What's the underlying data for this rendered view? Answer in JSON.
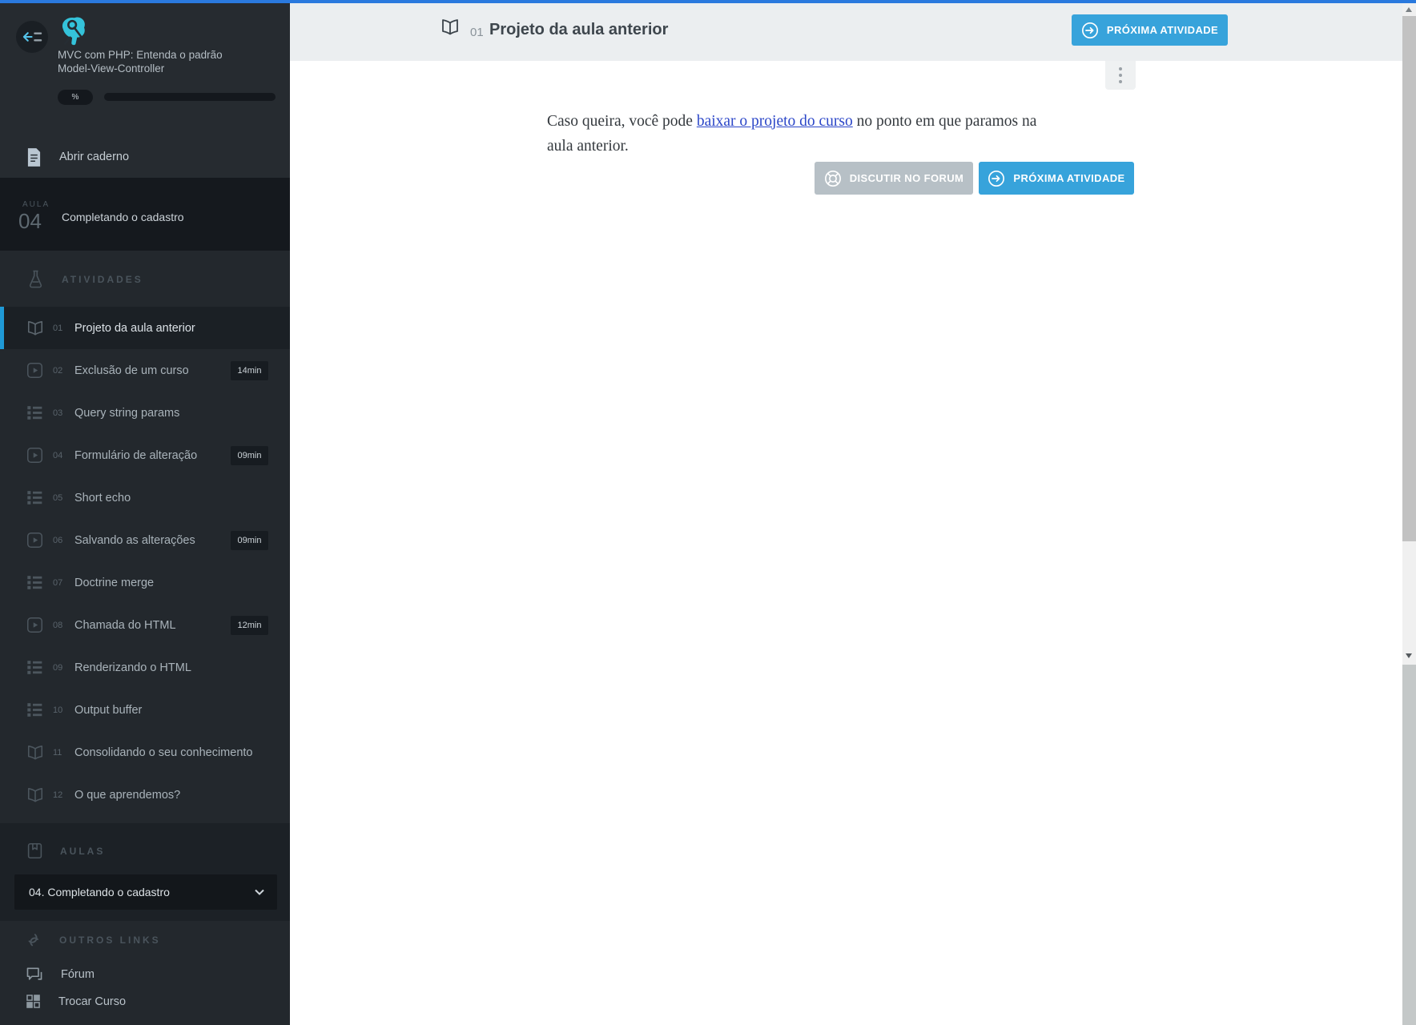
{
  "colors": {
    "top_line": "#2a79de",
    "active_accent": "#1f9ad7",
    "primary_button": "#37a3db",
    "forum_button": "#b7c0c6",
    "link_blue": "#2b46c8"
  },
  "sidebar": {
    "course_title_line1": "MVC com PHP: Entenda o padrão",
    "course_title_line2": "Model-View-Controller",
    "progress_label": "%",
    "notebook_label": "Abrir caderno",
    "aula": {
      "label": "AULA",
      "number": "04",
      "title": "Completando o cadastro"
    },
    "activities": {
      "header": "ATIVIDADES",
      "items": [
        {
          "num": "01",
          "label": "Projeto da aula anterior",
          "icon": "book",
          "active": true
        },
        {
          "num": "02",
          "label": "Exclusão de um curso",
          "icon": "video",
          "duration": "14min"
        },
        {
          "num": "03",
          "label": "Query string params",
          "icon": "list"
        },
        {
          "num": "04",
          "label": "Formulário de alteração",
          "icon": "video",
          "duration": "09min"
        },
        {
          "num": "05",
          "label": "Short echo",
          "icon": "list"
        },
        {
          "num": "06",
          "label": "Salvando as alterações",
          "icon": "video",
          "duration": "09min"
        },
        {
          "num": "07",
          "label": "Doctrine merge",
          "icon": "list"
        },
        {
          "num": "08",
          "label": "Chamada do HTML",
          "icon": "video",
          "duration": "12min"
        },
        {
          "num": "09",
          "label": "Renderizando o HTML",
          "icon": "list"
        },
        {
          "num": "10",
          "label": "Output buffer",
          "icon": "list"
        },
        {
          "num": "11",
          "label": "Consolidando o seu conhecimento",
          "icon": "book"
        },
        {
          "num": "12",
          "label": "O que aprendemos?",
          "icon": "book"
        }
      ]
    },
    "aulas": {
      "header": "AULAS",
      "selected": "04. Completando o cadastro"
    },
    "outros": {
      "header": "OUTROS LINKS",
      "forum": "Fórum",
      "trocar": "Trocar Curso"
    }
  },
  "main": {
    "header": {
      "num": "01",
      "title": "Projeto da aula anterior",
      "next_button": "PRÓXIMA ATIVIDADE"
    },
    "content": {
      "paragraph_prefix": "Caso queira, você pode ",
      "paragraph_link": "baixar o projeto do curso",
      "paragraph_suffix_line1": " no ponto em que paramos na",
      "paragraph_line2": "aula anterior.",
      "forum_button": "DISCUTIR NO FORUM",
      "next_button": "PRÓXIMA ATIVIDADE"
    }
  }
}
